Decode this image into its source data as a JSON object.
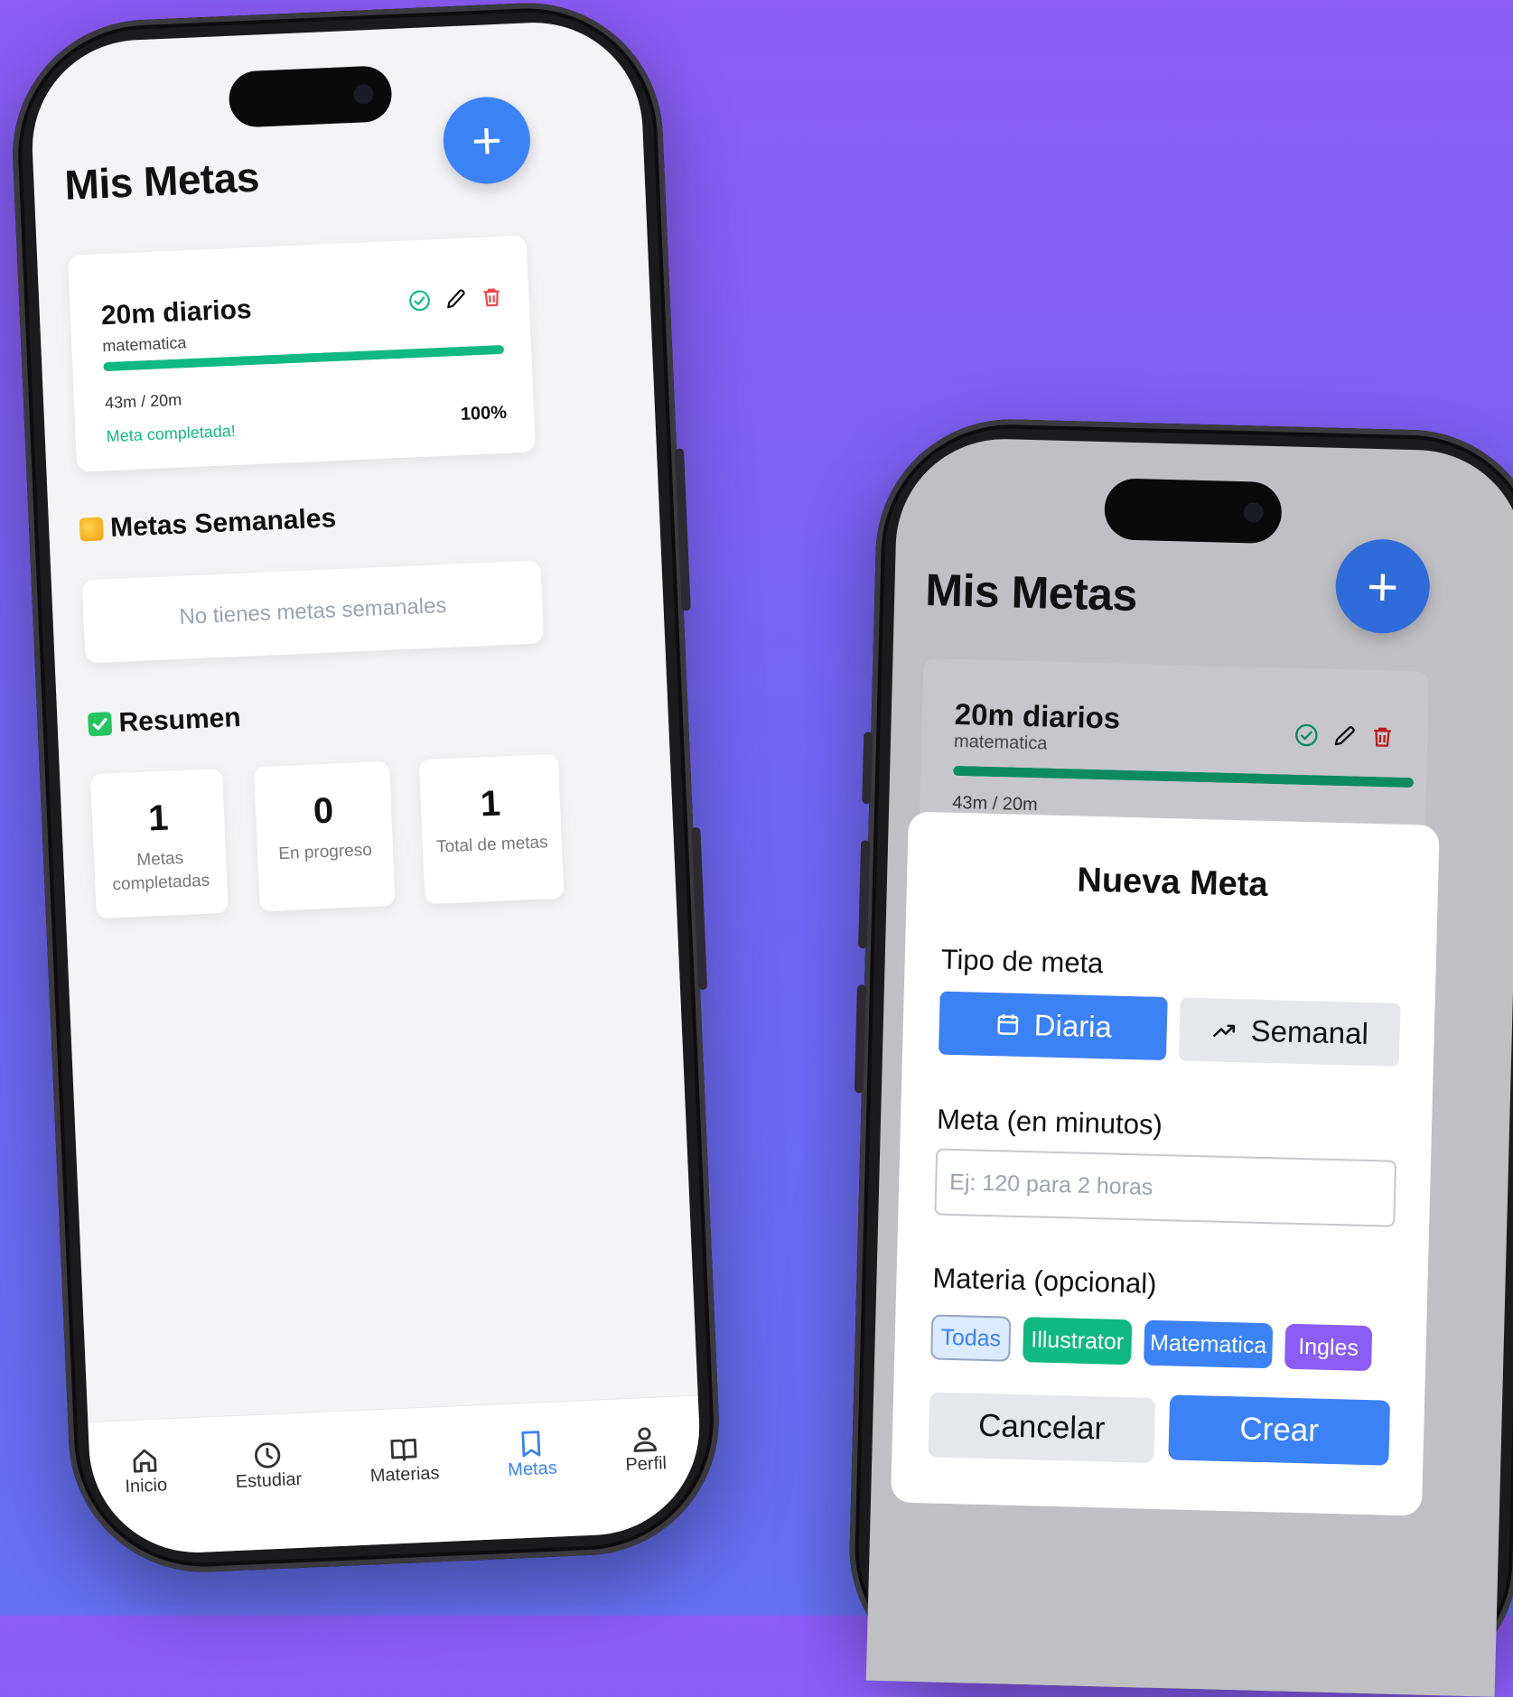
{
  "colors": {
    "accent": "#3b82f6",
    "success": "#10b981",
    "danger": "#ef4444",
    "purple": "#8b5cf6"
  },
  "screen1": {
    "title": "Mis Metas",
    "fab_label": "+",
    "goal": {
      "title": "20m diarios",
      "subject": "matematica",
      "progress_text": "43m / 20m",
      "status": "Meta completada!",
      "percent_label": "100%",
      "progress": 1.0,
      "icons": [
        "check-circle-icon",
        "pencil-icon",
        "trash-icon"
      ]
    },
    "weekly": {
      "title": "Metas Semanales",
      "empty": "No tienes metas semanales"
    },
    "summary": {
      "title": "Resumen",
      "stats": [
        {
          "value": "1",
          "label": "Metas completadas"
        },
        {
          "value": "0",
          "label": "En progreso"
        },
        {
          "value": "1",
          "label": "Total de metas"
        }
      ]
    },
    "tabs": [
      {
        "label": "Inicio",
        "icon": "home-icon"
      },
      {
        "label": "Estudiar",
        "icon": "clock-icon"
      },
      {
        "label": "Materias",
        "icon": "book-icon"
      },
      {
        "label": "Metas",
        "icon": "bookmark-icon",
        "active": true
      },
      {
        "label": "Perfil",
        "icon": "user-icon"
      }
    ]
  },
  "screen2": {
    "title": "Mis Metas",
    "fab_label": "+",
    "goal": {
      "title": "20m diarios",
      "subject": "matematica",
      "progress_text": "43m / 20m",
      "progress": 1.0
    },
    "modal": {
      "title": "Nueva Meta",
      "type_label": "Tipo de meta",
      "type_daily": "Diaria",
      "type_weekly": "Semanal",
      "minutes_label": "Meta (en minutos)",
      "minutes_placeholder": "Ej: 120 para 2 horas",
      "minutes_value": "",
      "subject_label": "Materia (opcional)",
      "subjects": [
        {
          "label": "Todas",
          "color": "#dbeafe"
        },
        {
          "label": "Illustrator",
          "color": "#10b981"
        },
        {
          "label": "Matematica",
          "color": "#3b82f6"
        },
        {
          "label": "Ingles",
          "color": "#8b5cf6"
        }
      ],
      "cancel_label": "Cancelar",
      "create_label": "Crear"
    }
  }
}
